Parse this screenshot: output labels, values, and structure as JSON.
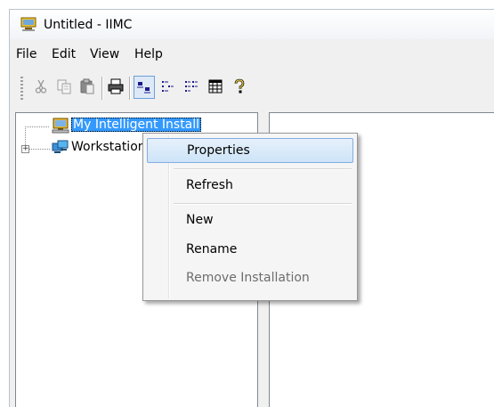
{
  "window": {
    "title": "Untitled - IIMC"
  },
  "menubar": {
    "items": [
      "File",
      "Edit",
      "View",
      "Help"
    ]
  },
  "toolbar": {
    "buttons": [
      {
        "icon": "cut-icon",
        "enabled": false
      },
      {
        "icon": "copy-icon",
        "enabled": false
      },
      {
        "icon": "paste-icon",
        "enabled": false
      },
      {
        "icon": "print-icon",
        "enabled": true
      },
      {
        "icon": "large-icons-view-icon",
        "enabled": true,
        "pressed": true
      },
      {
        "icon": "small-icons-view-icon",
        "enabled": true
      },
      {
        "icon": "list-view-icon",
        "enabled": true
      },
      {
        "icon": "details-view-icon",
        "enabled": true
      },
      {
        "icon": "help-icon",
        "enabled": true
      }
    ]
  },
  "tree": {
    "nodes": [
      {
        "label": "My Intelligent Install",
        "icon": "computer-icon",
        "selected": true
      },
      {
        "label": "Workstations",
        "icon": "workstations-icon",
        "collapsed": true
      }
    ]
  },
  "context_menu": {
    "items": [
      {
        "label": "Properties",
        "highlighted": true
      },
      {
        "label": "Refresh"
      },
      {
        "label": "New"
      },
      {
        "label": "Rename"
      },
      {
        "label": "Remove Installation",
        "disabled": true
      }
    ]
  },
  "colors": {
    "selection": "#3399ff",
    "menu_hover_border": "#84ade0",
    "disabled_text": "#6d6d6d"
  }
}
